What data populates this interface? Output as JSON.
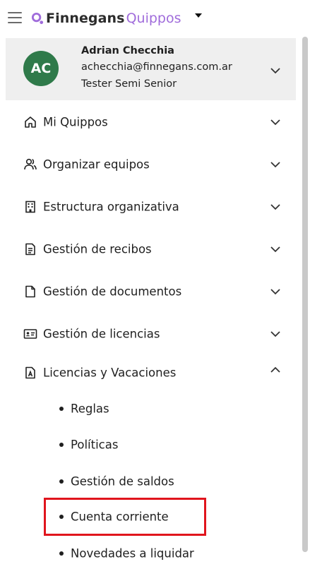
{
  "header": {
    "logo_word1": "Finnegans",
    "logo_word2": "Quippos",
    "logo_color": "#a06cdb"
  },
  "user": {
    "initials": "AC",
    "name": "Adrian Checchia",
    "email": "achecchia@finnegans.com.ar",
    "role": "Tester Semi Senior",
    "avatar_color": "#2f7a4a"
  },
  "menu": {
    "items": [
      {
        "label": "Mi Quippos",
        "icon": "home-icon"
      },
      {
        "label": "Organizar equipos",
        "icon": "users-icon"
      },
      {
        "label": "Estructura organizativa",
        "icon": "building-icon"
      },
      {
        "label": "Gestión de recibos",
        "icon": "receipt-icon"
      },
      {
        "label": "Gestión de documentos",
        "icon": "document-icon"
      },
      {
        "label": "Gestión de licencias",
        "icon": "id-card-icon"
      },
      {
        "label": "Licencias y Vacaciones",
        "icon": "vacation-doc-icon",
        "expanded": true
      }
    ],
    "sub_items": [
      {
        "label": "Reglas"
      },
      {
        "label": "Políticas"
      },
      {
        "label": "Gestión de saldos"
      },
      {
        "label": "Cuenta corriente",
        "highlighted": true
      },
      {
        "label": "Novedades a liquidar"
      }
    ]
  },
  "highlight_color": "#e0151d"
}
